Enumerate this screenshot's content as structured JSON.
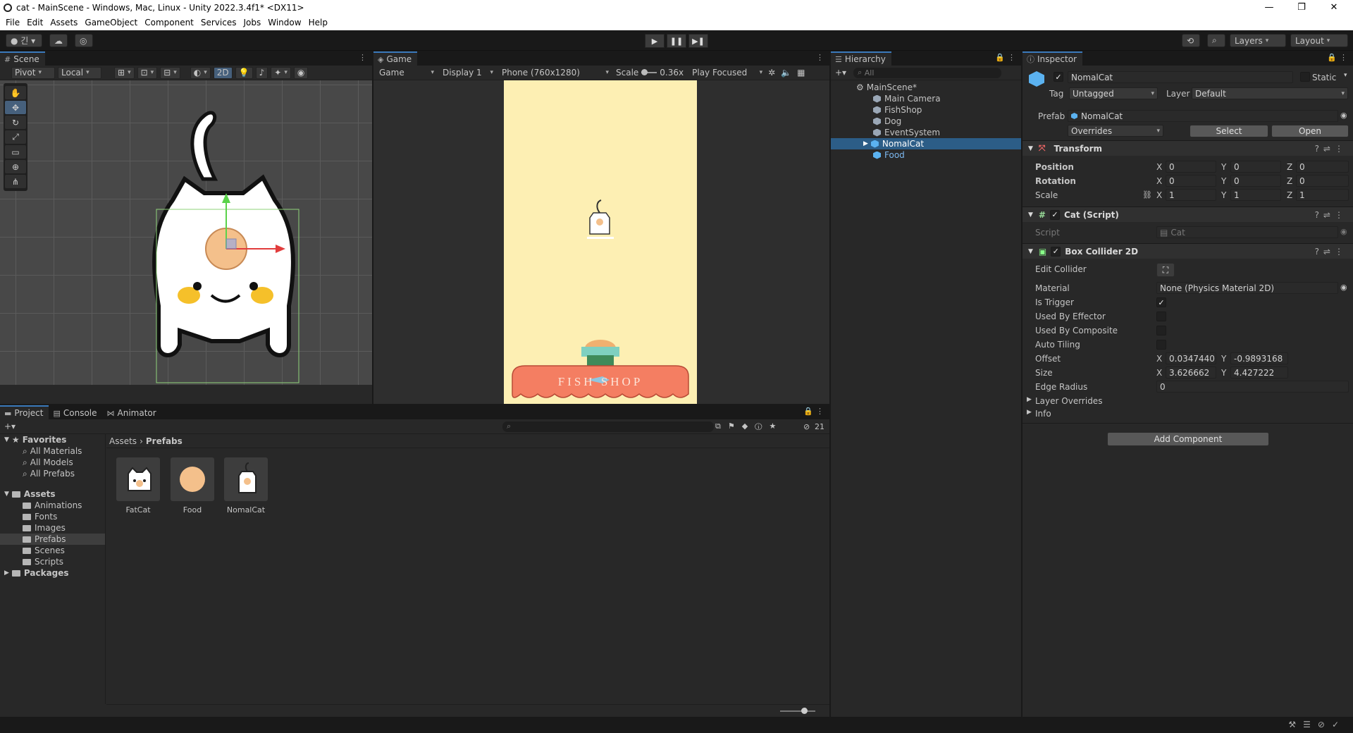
{
  "window": {
    "title": "cat - MainScene - Windows, Mac, Linux - Unity 2022.3.4f1* <DX11>",
    "minimize": "—",
    "maximize": "❐",
    "close": "✕"
  },
  "menu": [
    "File",
    "Edit",
    "Assets",
    "GameObject",
    "Component",
    "Services",
    "Jobs",
    "Window",
    "Help"
  ],
  "toolbar": {
    "account": "긴",
    "layers": "Layers",
    "layout": "Layout",
    "play": "▶",
    "pause": "❚❚",
    "step": "▶❚"
  },
  "scene": {
    "tab": "Scene",
    "pivot": "Pivot",
    "local": "Local",
    "mode_2d": "2D"
  },
  "game": {
    "tab": "Game",
    "view": "Game",
    "display": "Display 1",
    "resolution": "Phone (760x1280)",
    "scale_label": "Scale",
    "scale_value": "0.36x",
    "play_focused": "Play Focused",
    "shop_sign": "FISH   SHOP"
  },
  "hierarchy": {
    "tab": "Hierarchy",
    "search_placeholder": "All",
    "scene": "MainScene*",
    "items": [
      "Main Camera",
      "FishShop",
      "Dog",
      "EventSystem",
      "NomalCat",
      "Food"
    ],
    "selected": "NomalCat"
  },
  "inspector": {
    "tab": "Inspector",
    "object_name": "NomalCat",
    "static": "Static",
    "tag_label": "Tag",
    "tag_value": "Untagged",
    "layer_label": "Layer",
    "layer_value": "Default",
    "prefab_label": "Prefab",
    "prefab_value": "NomalCat",
    "overrides": "Overrides",
    "select": "Select",
    "open": "Open",
    "transform": {
      "title": "Transform",
      "position": "Position",
      "rotation": "Rotation",
      "scale": "Scale",
      "pos": [
        "0",
        "0",
        "0"
      ],
      "rot": [
        "0",
        "0",
        "0"
      ],
      "scl": [
        "1",
        "1",
        "1"
      ]
    },
    "cat_script": {
      "title": "Cat (Script)",
      "script_label": "Script",
      "script_value": "Cat"
    },
    "box_collider": {
      "title": "Box Collider 2D",
      "edit_collider": "Edit Collider",
      "material_label": "Material",
      "material_value": "None (Physics Material 2D)",
      "is_trigger": "Is Trigger",
      "used_by_effector": "Used By Effector",
      "used_by_composite": "Used By Composite",
      "auto_tiling": "Auto Tiling",
      "offset_label": "Offset",
      "offset_x": "0.0347440:",
      "offset_y": "-0.9893168",
      "size_label": "Size",
      "size_x": "3.626662",
      "size_y": "4.427222",
      "edge_radius_label": "Edge Radius",
      "edge_radius": "0",
      "layer_overrides": "Layer Overrides",
      "info": "Info"
    },
    "add_component": "Add Component",
    "axis": [
      "X",
      "Y",
      "Z"
    ]
  },
  "project": {
    "tabs": [
      "Project",
      "Console",
      "Animator"
    ],
    "badge": "21",
    "favorites": "Favorites",
    "fav_items": [
      "All Materials",
      "All Models",
      "All Prefabs"
    ],
    "assets": "Assets",
    "folders": [
      "Animations",
      "Fonts",
      "Images",
      "Prefabs",
      "Scenes",
      "Scripts"
    ],
    "packages": "Packages",
    "breadcrumb_root": "Assets",
    "breadcrumb_current": "Prefabs",
    "prefabs": [
      "FatCat",
      "Food",
      "NomalCat"
    ]
  }
}
